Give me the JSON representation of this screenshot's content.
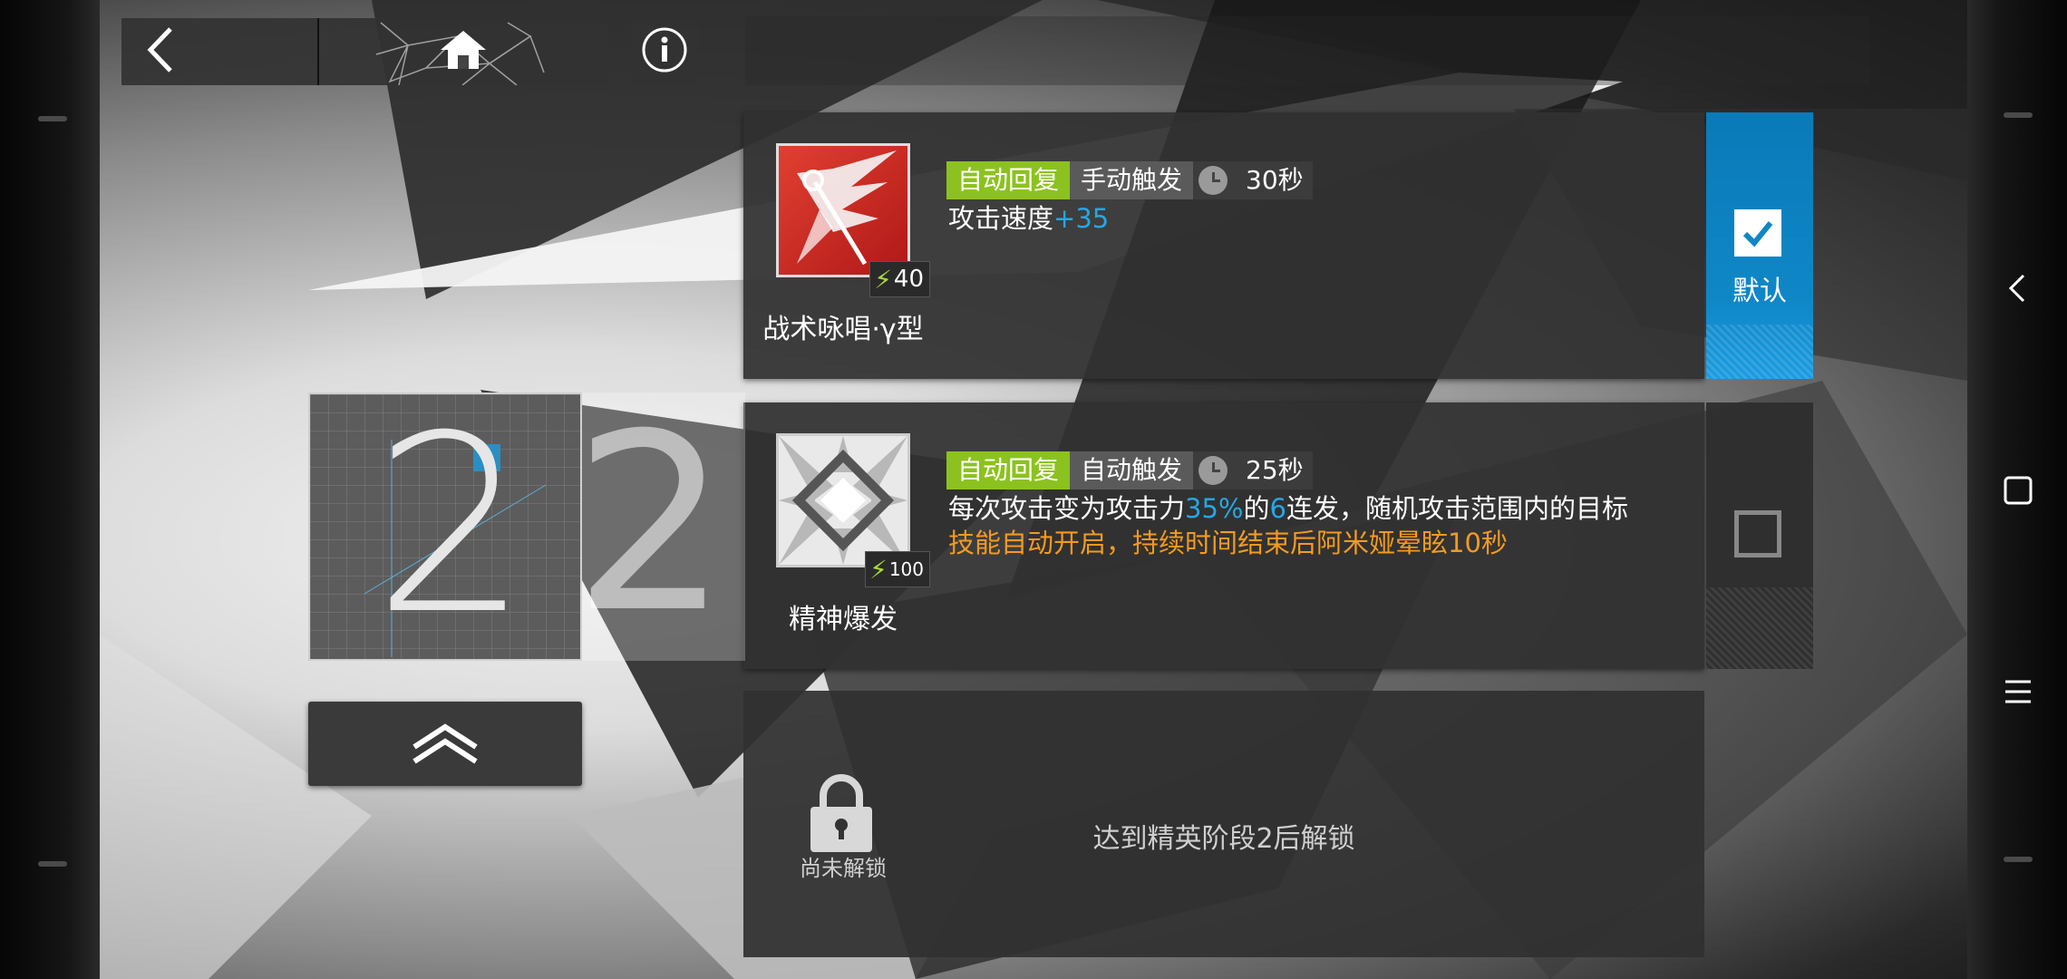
{
  "topbar": {
    "back_icon": "chevron-left-icon",
    "home_icon": "home-icon",
    "info_icon": "info-icon"
  },
  "elite": {
    "level": "2",
    "promote_icon": "double-chevron-up-icon"
  },
  "skills": [
    {
      "name": "战术咏唱·γ型",
      "sp_cost": "40",
      "recovery_tag": "自动回复",
      "trigger_tag": "手动触发",
      "duration": "30秒",
      "desc_text": "攻击速度",
      "desc_bonus": "+35",
      "default_label": "默认",
      "is_default": true
    },
    {
      "name": "精神爆发",
      "sp_cost": "100",
      "recovery_tag": "自动回复",
      "trigger_tag": "自动触发",
      "duration": "25秒",
      "desc_part1": "每次攻击变为攻击力",
      "desc_atk": "35%",
      "desc_part2": "的",
      "desc_hits": "6",
      "desc_part3": "连发，随机攻击范围内的目标",
      "desc_warning": "技能自动开启，持续时间结束后阿米娅晕眩10秒",
      "is_default": false
    },
    {
      "locked": true,
      "lock_label": "尚未解锁",
      "unlock_condition": "达到精英阶段2后解锁"
    }
  ],
  "colors": {
    "accent_blue": "#0f87c7",
    "tag_green": "#8cc21f",
    "highlight_blue": "#24a7e6",
    "warning_orange": "#f39a1f"
  }
}
